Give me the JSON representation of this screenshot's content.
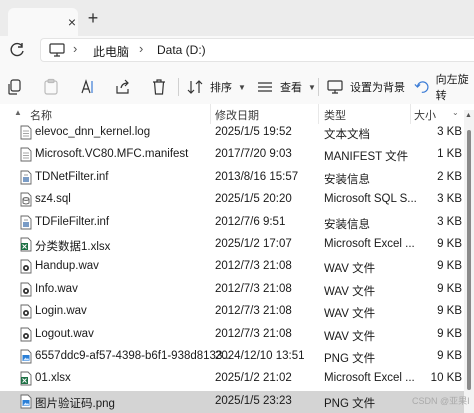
{
  "tabs": {
    "close_glyph": "×",
    "new_tab_glyph": "+"
  },
  "address": {
    "crumbs": [
      "此电脑",
      "Data (D:)"
    ],
    "separator": "›"
  },
  "toolbar": {
    "sort_label": "排序",
    "view_label": "查看",
    "wallpaper_label": "设置为背景",
    "rotate_label": "向左旋转"
  },
  "columns": {
    "name": "名称",
    "date": "修改日期",
    "type": "类型",
    "size": "大小"
  },
  "files": [
    {
      "name": "elevoc_dnn_kernel.log",
      "date": "2025/1/5 19:52",
      "type": "文本文档",
      "size": "3 KB",
      "icon": "text-file-icon"
    },
    {
      "name": "Microsoft.VC80.MFC.manifest",
      "date": "2017/7/20 9:03",
      "type": "MANIFEST 文件",
      "size": "1 KB",
      "icon": "text-file-icon"
    },
    {
      "name": "TDNetFilter.inf",
      "date": "2013/8/16 15:57",
      "type": "安装信息",
      "size": "2 KB",
      "icon": "setup-info-icon"
    },
    {
      "name": "sz4.sql",
      "date": "2025/1/5 20:20",
      "type": "Microsoft SQL S...",
      "size": "3 KB",
      "icon": "sql-file-icon"
    },
    {
      "name": "TDFileFilter.inf",
      "date": "2012/7/6 9:51",
      "type": "安装信息",
      "size": "3 KB",
      "icon": "setup-info-icon"
    },
    {
      "name": "分类数据1.xlsx",
      "date": "2025/1/2 17:07",
      "type": "Microsoft Excel ...",
      "size": "9 KB",
      "icon": "excel-file-icon"
    },
    {
      "name": "Handup.wav",
      "date": "2012/7/3 21:08",
      "type": "WAV 文件",
      "size": "9 KB",
      "icon": "audio-file-icon"
    },
    {
      "name": "Info.wav",
      "date": "2012/7/3 21:08",
      "type": "WAV 文件",
      "size": "9 KB",
      "icon": "audio-file-icon"
    },
    {
      "name": "Login.wav",
      "date": "2012/7/3 21:08",
      "type": "WAV 文件",
      "size": "9 KB",
      "icon": "audio-file-icon"
    },
    {
      "name": "Logout.wav",
      "date": "2012/7/3 21:08",
      "type": "WAV 文件",
      "size": "9 KB",
      "icon": "audio-file-icon"
    },
    {
      "name": "6557ddc9-af57-4398-b6f1-938d8133...",
      "date": "2024/12/10 13:51",
      "type": "PNG 文件",
      "size": "9 KB",
      "icon": "image-file-icon"
    },
    {
      "name": "01.xlsx",
      "date": "2025/1/2 21:02",
      "type": "Microsoft Excel ...",
      "size": "10 KB",
      "icon": "excel-file-icon"
    },
    {
      "name": "图片验证码.png",
      "date": "2025/1/5 23:23",
      "type": "PNG 文件",
      "size": "",
      "icon": "image-file-icon",
      "selected": true
    }
  ],
  "watermark": "CSDN @亚果I",
  "colors": {
    "excel": "#1d7044",
    "image": "#2b7fd6",
    "selected_row": "#d4d4d4",
    "rotate_icon": "#3b7cd6"
  }
}
